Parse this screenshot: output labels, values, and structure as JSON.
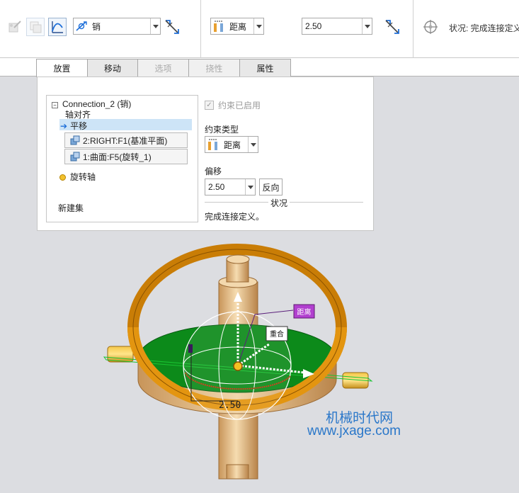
{
  "toolbar": {
    "connection_type": "销",
    "constraint_type": "距离",
    "offset_value": "2.50",
    "status_label": "状况: 完成连接定义",
    "icons": [
      "user-defined-icon",
      "copy-icon",
      "curve-icon",
      "pin-connection-icon",
      "flip-icon",
      "distance-constraint-icon",
      "flip-icon",
      "move-handle-icon"
    ]
  },
  "tabs": [
    {
      "label": "放置",
      "state": "active"
    },
    {
      "label": "移动",
      "state": "normal"
    },
    {
      "label": "选项",
      "state": "disabled"
    },
    {
      "label": "挠性",
      "state": "disabled"
    },
    {
      "label": "属性",
      "state": "normal"
    }
  ],
  "tree": {
    "connection": "Connection_2 (销)",
    "axis_align": "轴对齐",
    "translate": "平移",
    "ref1": "2:RIGHT:F1(基准平面)",
    "ref2": "1:曲面:F5(旋转_1)",
    "rotation_axis": "旋转轴",
    "new_set": "新建集"
  },
  "constraint": {
    "enabled_label": "约束已启用",
    "type_label": "约束类型",
    "type_value": "距离",
    "offset_label": "偏移",
    "offset_value": "2.50",
    "flip_label": "反向",
    "status_title": "状况",
    "status_text": "完成连接定义。"
  },
  "viewport": {
    "tag_distance": "距离",
    "tag_coincident": "重合",
    "dimension": "2.50"
  },
  "watermark": {
    "line1": "机械时代网",
    "line2": "www.jxage.com"
  },
  "colors": {
    "accent_blue": "#1e6fd9",
    "green_surface": "#0c8a1a",
    "ring_orange": "#d98a0a",
    "shaft": "#e8c48a"
  }
}
